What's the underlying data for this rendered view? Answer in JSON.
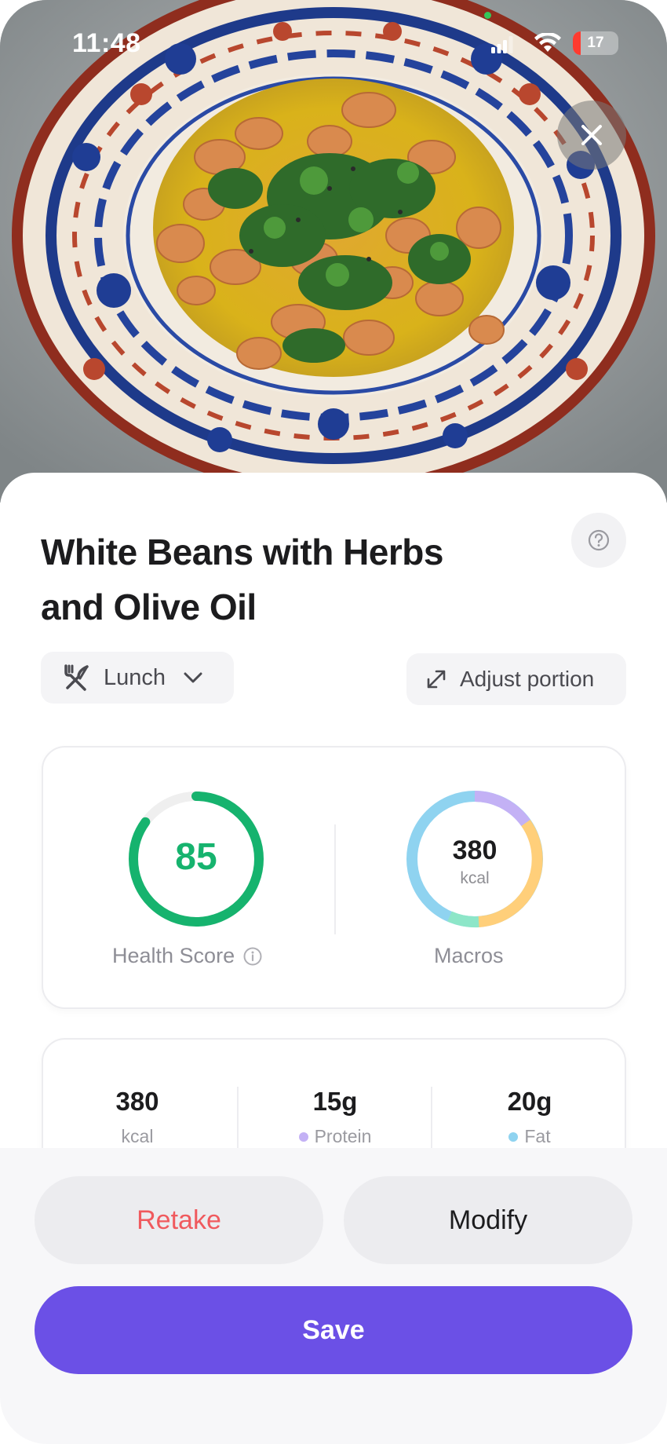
{
  "status_bar": {
    "time": "11:48",
    "battery_level": "17",
    "icons": [
      "signal-icon",
      "wifi-icon",
      "battery-icon"
    ]
  },
  "header": {
    "close_icon": "close-icon",
    "photo": "white-beans-plate-photo"
  },
  "meal": {
    "title": "White Beans with Herbs and Olive Oil",
    "help_icon": "question-circle-icon",
    "meal_type": "Lunch",
    "meal_type_icon": "fork-knife-icon",
    "adjust_portion_label": "Adjust portion",
    "adjust_portion_icon": "expand-arrows-icon"
  },
  "summary": {
    "health_score": "85",
    "health_score_fraction": 0.85,
    "health_score_label": "Health Score",
    "info_icon": "info-circle-icon",
    "macros_kcal": "380",
    "macros_unit": "kcal",
    "macros_label": "Macros"
  },
  "macro_breakdown": [
    {
      "value": "380",
      "label": "kcal",
      "dot_color": ""
    },
    {
      "value": "15g",
      "label": "Protein",
      "dot_color": "#c3b1f5"
    },
    {
      "value": "20g",
      "label": "Fat",
      "dot_color": "#8fd3f0"
    }
  ],
  "colors": {
    "health_green": "#16b36e",
    "protein": "#c3b1f5",
    "carbs": "#ffcf7a",
    "fiber": "#8de6c8",
    "fat": "#8fd3f0",
    "accent": "#6b50e6",
    "retake": "#f05a5e"
  },
  "actions": {
    "retake_label": "Retake",
    "modify_label": "Modify",
    "save_label": "Save"
  }
}
